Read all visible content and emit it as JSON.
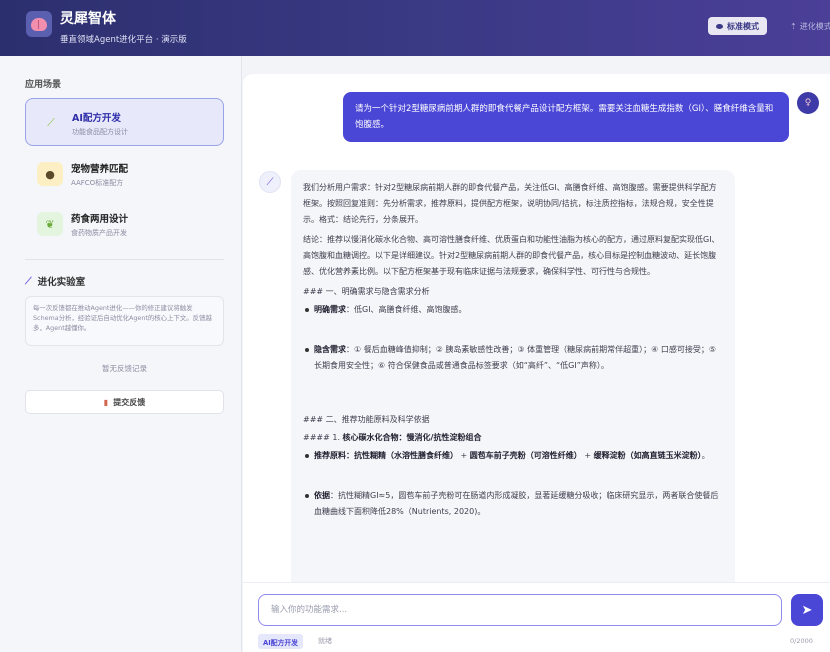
{
  "header": {
    "title": "灵犀智体",
    "subtitle": "垂直领域Agent进化平台 · 演示版",
    "mode_standard": "标准模式",
    "mode_evolution": "进化模式"
  },
  "sidebar": {
    "section_label": "应用场景",
    "cards": [
      {
        "title": "AI配方开发",
        "subtitle": "功能食品配方设计",
        "icon": "flask-icon",
        "active": true
      },
      {
        "title": "宠物营养匹配",
        "subtitle": "AAFCO标准配方",
        "icon": "paw-icon",
        "active": false
      },
      {
        "title": "药食两用设计",
        "subtitle": "食药物质产品开发",
        "icon": "herb-icon",
        "active": false
      }
    ],
    "lab_title": "进化实验室",
    "lab_desc": "每一次反馈都在推动Agent进化——你的修正建议将触发Schema分析，经验证后自动优化Agent的核心上下文。反馈越多，Agent越懂你。",
    "no_feedback": "暂无反馈记录",
    "feedback_button": "提交反馈"
  },
  "chat": {
    "user_message": "请为一个针对2型糖尿病前期人群的即食代餐产品设计配方框架。需要关注血糖生成指数（GI）、膳食纤维含量和饱腹感。",
    "ai": {
      "p1": "我们分析用户需求：针对2型糖尿病前期人群的即食代餐产品，关注低GI、高膳食纤维、高饱腹感。需要提供科学配方框架。按照回复准则：先分析需求，推荐原料，提供配方框架，说明协同/拮抗，标注质控指标，法规合规，安全性提示。格式：结论先行，分条展开。",
      "p2": "结论：推荐以慢消化碳水化合物、高可溶性膳食纤维、优质蛋白和功能性油脂为核心的配方，通过原料复配实现低GI、高饱腹和血糖调控。以下是详细建议。针对2型糖尿病前期人群的即食代餐产品，核心目标是控制血糖波动、延长饱腹感、优化营养素比例。以下配方框架基于现有临床证据与法规要求，确保科学性、可行性与合规性。",
      "h1": "### 一、明确需求与隐含需求分析",
      "b1_label": "明确需求",
      "b1_text": "：低GI、高膳食纤维、高饱腹感。",
      "b2_label": "隐含需求",
      "b2_text": "：① 餐后血糖峰值抑制；② 胰岛素敏感性改善；③ 体重管理（糖尿病前期常伴超重）；④ 口感可接受；⑤ 长期食用安全性；⑥ 符合保健食品或普通食品标签要求（如“高纤”、“低GI”声称）。",
      "h2": "### 二、推荐功能原料及科学依据",
      "h3_prefix": "#### 1. ",
      "h3_bold": "核心碳水化合物：慢消化/抗性淀粉组合",
      "b3_label": "推荐原料：抗性糊精（水溶性膳食纤维）",
      "b3_mid": " + ",
      "b3_bold2": "圆苞车前子壳粉（可溶性纤维）",
      "b3_mid2": " + ",
      "b3_bold3": "缓释淀粉（如高直链玉米淀粉）",
      "b3_end": "。",
      "b4_label": "依据",
      "b4_text": "：抗性糊精GI≈5，圆苞车前子壳粉可在肠道内形成凝胶，显著延缓糖分吸收；临床研究显示，两者联合使餐后血糖曲线下面积降低28%（Nutrients, 2020)。"
    }
  },
  "composer": {
    "placeholder": "输入你的功能需求...",
    "chip": "AI配方开发",
    "status": "就绪",
    "counter": "0/2000"
  },
  "colors": {
    "accent": "#4b47d6",
    "header_start": "#2c2f6e",
    "header_end": "#4b3f98"
  }
}
